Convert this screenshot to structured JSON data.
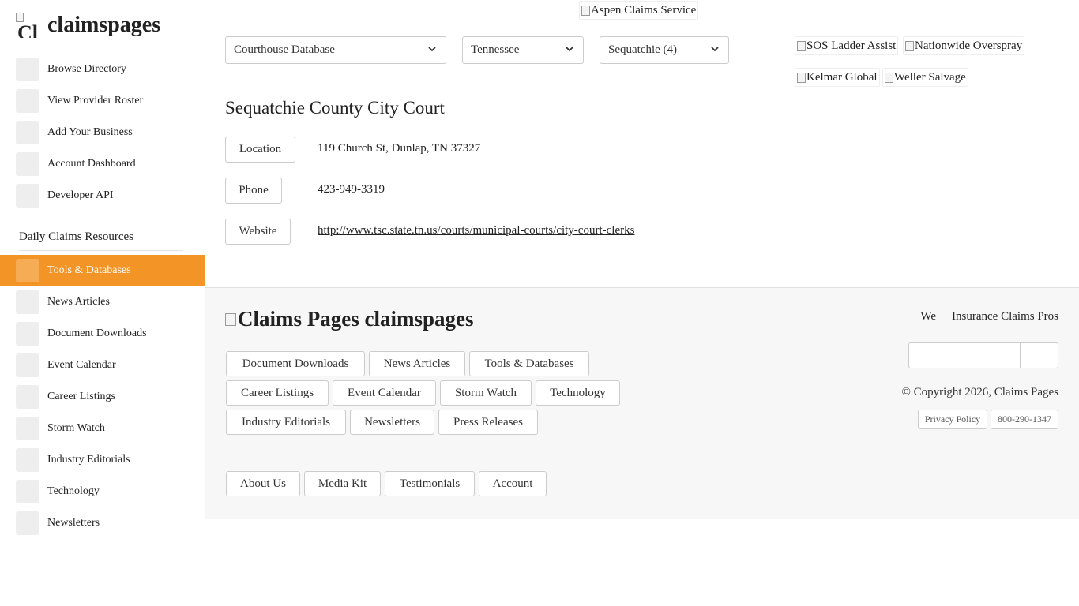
{
  "brand": {
    "name": "claimspages",
    "logo_alt": "Cl"
  },
  "sidebar": {
    "top_items": [
      {
        "label": "Browse Directory",
        "icon": "directory-icon"
      },
      {
        "label": "View Provider Roster",
        "icon": "roster-icon"
      },
      {
        "label": "Add Your Business",
        "icon": "add-business-icon"
      },
      {
        "label": "Account Dashboard",
        "icon": "dashboard-icon"
      },
      {
        "label": "Developer API",
        "icon": "api-icon"
      }
    ],
    "section_title": "Daily Claims Resources",
    "resource_items": [
      {
        "label": "Tools & Databases",
        "icon": "tools-icon",
        "active": true
      },
      {
        "label": "News Articles",
        "icon": "news-icon"
      },
      {
        "label": "Document Downloads",
        "icon": "download-icon"
      },
      {
        "label": "Event Calendar",
        "icon": "calendar-icon"
      },
      {
        "label": "Career Listings",
        "icon": "career-icon"
      },
      {
        "label": "Storm Watch",
        "icon": "storm-icon"
      },
      {
        "label": "Industry Editorials",
        "icon": "editorial-icon"
      },
      {
        "label": "Technology",
        "icon": "technology-icon"
      },
      {
        "label": "Newsletters",
        "icon": "newsletter-icon"
      }
    ],
    "icon_glyph": "",
    "active_color": "#f39426"
  },
  "filters": {
    "database": "Courthouse Database",
    "state": "Tennessee",
    "county": "Sequatchie (4)"
  },
  "ads": {
    "top": "Aspen Claims Service",
    "sos": "SOS Ladder Assist",
    "nationwide": "Nationwide Overspray",
    "kelmar": "Kelmar Global",
    "weller": "Weller Salvage"
  },
  "court": {
    "title": "Sequatchie County City Court",
    "location_label": "Location",
    "location": "119 Church St, Dunlap, TN 37327",
    "phone_label": "Phone",
    "phone": "423-949-3319",
    "website_label": "Website",
    "website": "http://www.tsc.state.tn.us/courts/municipal-courts/city-court-clerks"
  },
  "footer": {
    "logo_alt": "Claims Pages",
    "logo_text": "claimspages",
    "links": {
      "document_downloads": "Document Downloads",
      "news_articles": "News Articles",
      "tools_databases": "Tools & Databases",
      "career_listings": "Career Listings",
      "event_calendar": "Event Calendar",
      "storm_watch": "Storm Watch",
      "technology": "Technology",
      "industry_editorials": "Industry Editorials",
      "newsletters": "Newsletters",
      "press_releases": "Press Releases"
    },
    "secondary": {
      "about": "About Us",
      "media_kit": "Media Kit",
      "testimonials": "Testimonials",
      "account": "Account"
    },
    "tagline_start": "We",
    "tagline_end": "Insurance Claims Pros",
    "social_icons": [
      "facebook-icon",
      "twitter-icon",
      "linkedin-icon",
      "youtube-icon"
    ],
    "copyright": "© Copyright 2026, Claims Pages",
    "privacy": "Privacy Policy",
    "phone": "800-290-1347"
  }
}
